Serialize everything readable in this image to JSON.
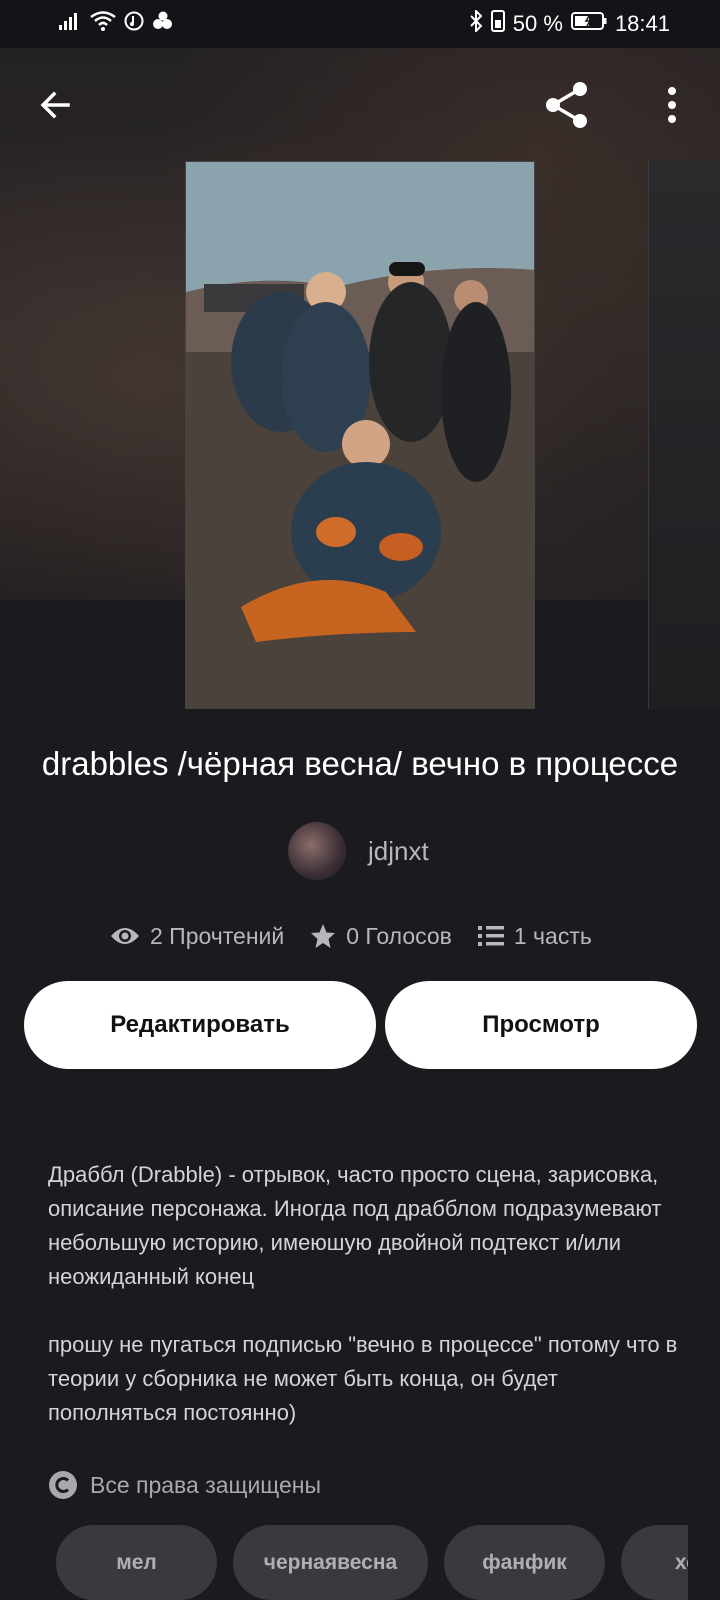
{
  "status_bar": {
    "battery": "50 %",
    "time": "18:41"
  },
  "top_bar": {
    "back_icon": "arrow-left-icon",
    "share_icon": "share-icon",
    "more_icon": "more-vertical-icon"
  },
  "story": {
    "title": "drabbles /чёрная весна/ вечно в процессе",
    "author": "jdjnxt",
    "stats": {
      "reads": "2 Прочтений",
      "votes": "0 Голосов",
      "parts": "1 часть"
    },
    "buttons": {
      "edit": "Редактировать",
      "view": "Просмотр"
    },
    "description": [
      "Драббл (Drabble) - отрывок, часто просто сцена, зарисовка, описание персонажа. Иногда под драбблом подразумевают небольшую историю, имеюшую двойной подтекст и/или неожиданный конец",
      "прошу не пугаться подписью \"вечно в процессе\" потому что в теории у сборника не может быть конца, он будет пополняться постоянно)"
    ],
    "copyright": "Все права защищены",
    "tags": [
      "мел",
      "чернаявесна",
      "фанфик",
      "хе"
    ]
  },
  "colors": {
    "background": "#1b1a1f",
    "button_bg": "#ffffff",
    "tag_bg": "#3a393e",
    "secondary_text": "#b8b7bc"
  }
}
